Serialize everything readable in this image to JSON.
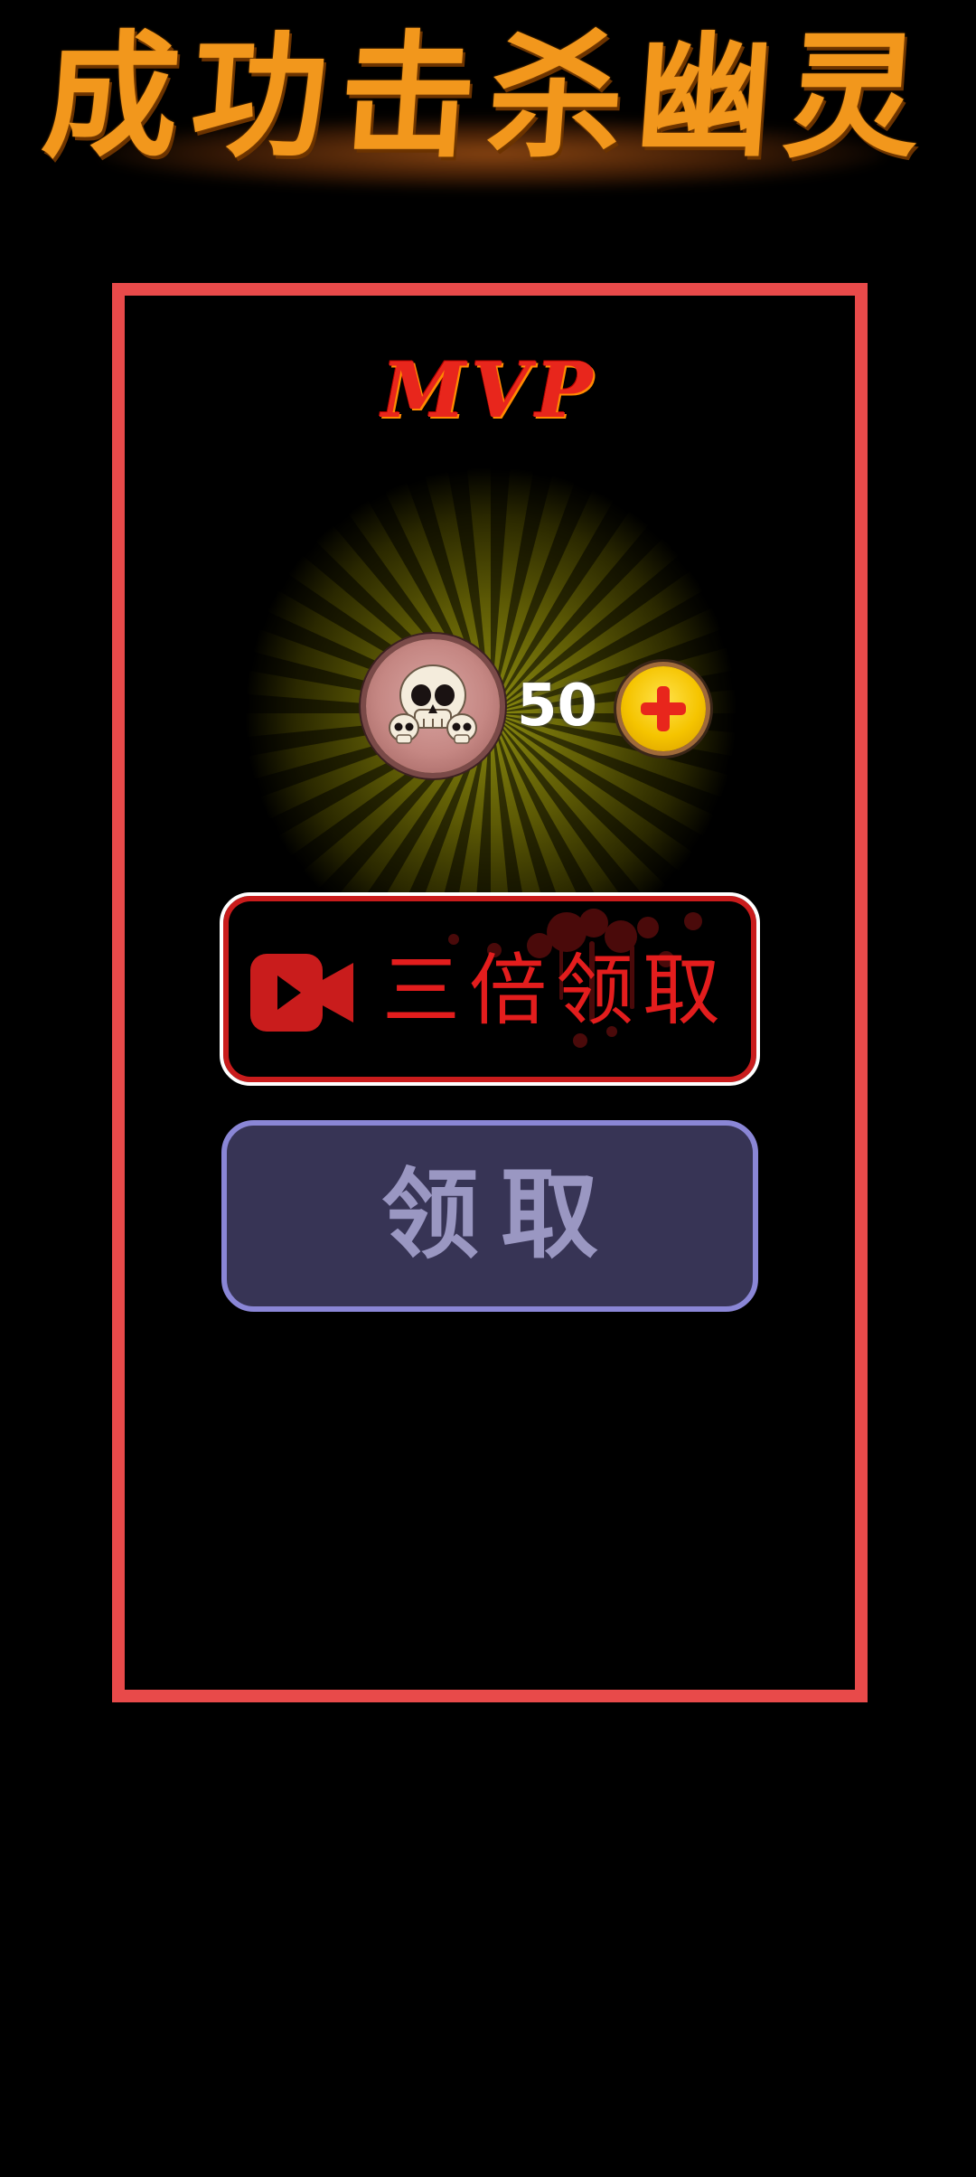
{
  "header": {
    "title": "成功击杀幽灵"
  },
  "dialog": {
    "badge": "MVP",
    "reward": {
      "icon": "skull-medal-icon",
      "amount": "50",
      "add_icon": "plus-coin-icon"
    },
    "buttons": {
      "triple_claim": {
        "icon": "video-camera-icon",
        "label": "三倍领取"
      },
      "claim": {
        "label": "领取"
      }
    }
  },
  "colors": {
    "title": "#f2971c",
    "frame": "#e84a4a",
    "triple_label": "#e31d1d",
    "claim_bg": "#373455",
    "claim_border": "#8a86d6",
    "claim_label": "#9a97c2",
    "coin": "#f5c400"
  }
}
